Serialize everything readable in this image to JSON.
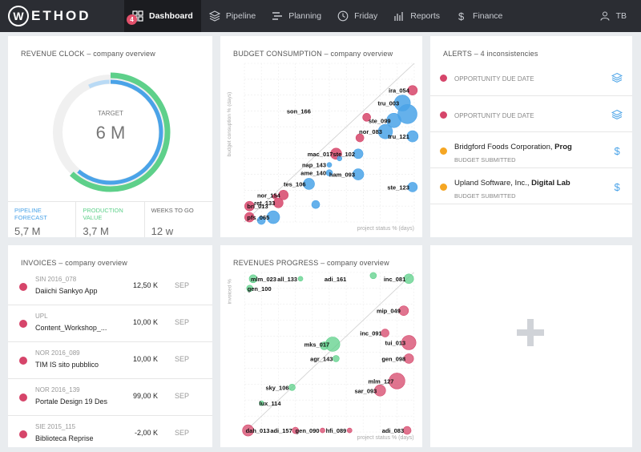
{
  "app": {
    "logo_letter": "W",
    "logo_text": "ETHOD"
  },
  "nav": {
    "items": [
      {
        "label": "Dashboard",
        "icon": "dashboard-grid-icon"
      },
      {
        "label": "Pipeline",
        "icon": "pipeline-layers-icon"
      },
      {
        "label": "Planning",
        "icon": "planning-bars-icon"
      },
      {
        "label": "Friday",
        "icon": "clock-icon"
      },
      {
        "label": "Reports",
        "icon": "bar-chart-icon"
      },
      {
        "label": "Finance",
        "icon": "dollar-icon"
      }
    ],
    "badge": "4",
    "user_initials": "TB"
  },
  "colors": {
    "red": "#d6456a",
    "blue": "#4aa3e8",
    "green": "#5ed08a",
    "orange": "#f5a623",
    "nav_bg": "#2b2d33"
  },
  "revenue_clock": {
    "title": "REVENUE CLOCK – company overview",
    "center_label": "TARGET",
    "center_value": "6 M",
    "green_fraction": 0.62,
    "blue_fraction": 0.61,
    "light_fraction": 0.07,
    "stats": [
      {
        "label": "PIPELINE FORECAST",
        "value": "5,7 M",
        "color": "#4aa3e8"
      },
      {
        "label": "PRODUCTION VALUE",
        "value": "3,7 M",
        "color": "#5ed08a"
      },
      {
        "label": "WEEKS TO GO",
        "value": "12 w",
        "color": "#666666"
      }
    ]
  },
  "budget": {
    "title": "BUDGET CONSUMPTION – company overview",
    "ylabel": "budget consuption % (days)",
    "xlabel": "project status % (days)"
  },
  "alerts": {
    "title": "ALERTS – 4 inconsistencies",
    "items": [
      {
        "type": "opportunity",
        "title": "OPPORTUNITY DUE DATE",
        "color": "#d6456a",
        "icon": "layers-icon"
      },
      {
        "type": "opportunity",
        "title": "OPPORTUNITY DUE DATE",
        "color": "#d6456a",
        "icon": "layers-icon"
      },
      {
        "type": "budget",
        "client": "Bridgford Foods Corporation,",
        "project": "Prog",
        "sub": "BUDGET SUBMITTED",
        "color": "#f5a623",
        "icon": "dollar-icon"
      },
      {
        "type": "budget",
        "client": "Upland Software, Inc.,",
        "project": "Digital Lab",
        "sub": "BUDGET SUBMITTED",
        "color": "#f5a623",
        "icon": "dollar-icon"
      }
    ]
  },
  "invoices": {
    "title": "INVOICES – company overview",
    "rows": [
      {
        "code": "SIN 2016_078",
        "name": "Daiichi Sankyo App",
        "amount": "12,50 K",
        "month": "SEP"
      },
      {
        "code": "UPL",
        "name": "Content_Workshop_...",
        "amount": "10,00 K",
        "month": "SEP"
      },
      {
        "code": "NOR 2016_089",
        "name": "TIM IS sito pubblico",
        "amount": "10,00 K",
        "month": "SEP"
      },
      {
        "code": "NOR 2016_139",
        "name": "Portale Design 19 Des",
        "amount": "99,00 K",
        "month": "SEP"
      },
      {
        "code": "SIE 2015_115",
        "name": "Biblioteca Reprise",
        "amount": "-2,00 K",
        "month": "SEP"
      }
    ]
  },
  "revenues_progress": {
    "title": "REVENUES PROGRESS – company overview",
    "ylabel": "invoiced %",
    "xlabel": "project status % (days)"
  },
  "chart_data": [
    {
      "type": "scatter",
      "title": "BUDGET CONSUMPTION – company overview",
      "xlabel": "project status % (days)",
      "ylabel": "budget consuption % (days)",
      "xlim": [
        0,
        100
      ],
      "ylim": [
        0,
        100
      ],
      "grid": true,
      "points": [
        {
          "label": "ira_054",
          "x": 99,
          "y": 83,
          "r": 6,
          "color": "red"
        },
        {
          "label": "tru_003",
          "x": 93,
          "y": 75,
          "r": 10,
          "color": "blue"
        },
        {
          "label": "son_166",
          "x": 41,
          "y": 70,
          "r": 0,
          "color": "red"
        },
        {
          "label": "",
          "x": 72,
          "y": 66,
          "r": 5,
          "color": "red"
        },
        {
          "label": "ste_099",
          "x": 88,
          "y": 64,
          "r": 9,
          "color": "blue"
        },
        {
          "label": "",
          "x": 96,
          "y": 68,
          "r": 12,
          "color": "blue"
        },
        {
          "label": "nor_083",
          "x": 83,
          "y": 57,
          "r": 9,
          "color": "blue"
        },
        {
          "label": "tru_121",
          "x": 99,
          "y": 54,
          "r": 7,
          "color": "blue"
        },
        {
          "label": "",
          "x": 68,
          "y": 53,
          "r": 5,
          "color": "red"
        },
        {
          "label": "ste_102",
          "x": 67,
          "y": 43,
          "r": 6,
          "color": "blue"
        },
        {
          "label": "mac_017",
          "x": 54,
          "y": 43,
          "r": 7,
          "color": "red"
        },
        {
          "label": "",
          "x": 56,
          "y": 40,
          "r": 3,
          "color": "blue"
        },
        {
          "label": "nap_143",
          "x": 50,
          "y": 36,
          "r": 3,
          "color": "blue"
        },
        {
          "label": "ame_140",
          "x": 50,
          "y": 31,
          "r": 4,
          "color": "blue"
        },
        {
          "label": "ham_093",
          "x": 67,
          "y": 30,
          "r": 7,
          "color": "blue"
        },
        {
          "label": "tes_106",
          "x": 38,
          "y": 24,
          "r": 7,
          "color": "blue"
        },
        {
          "label": "ste_123",
          "x": 99,
          "y": 22,
          "r": 6,
          "color": "blue"
        },
        {
          "label": "nor_154",
          "x": 23,
          "y": 17,
          "r": 6,
          "color": "red"
        },
        {
          "label": "ret_133",
          "x": 20,
          "y": 12,
          "r": 6,
          "color": "red"
        },
        {
          "label": "",
          "x": 42,
          "y": 11,
          "r": 5,
          "color": "blue"
        },
        {
          "label": "bri_013",
          "x": 3,
          "y": 10,
          "r": 6,
          "color": "red"
        },
        {
          "label": "",
          "x": 18,
          "y": 16,
          "r": 3,
          "color": "red"
        },
        {
          "label": "pfs_065",
          "x": 3,
          "y": 3,
          "r": 6,
          "color": "red"
        },
        {
          "label": "",
          "x": 17,
          "y": 3,
          "r": 8,
          "color": "blue"
        },
        {
          "label": "",
          "x": 10,
          "y": 1,
          "r": 5,
          "color": "blue"
        }
      ]
    },
    {
      "type": "scatter",
      "title": "REVENUES PROGRESS – company overview",
      "xlabel": "project status % (days)",
      "ylabel": "invoiced %",
      "xlim": [
        0,
        100
      ],
      "ylim": [
        0,
        100
      ],
      "grid": true,
      "points": [
        {
          "label": "mlm_023",
          "x": 5,
          "y": 96,
          "r": 5,
          "color": "green"
        },
        {
          "label": "all_133",
          "x": 33,
          "y": 96,
          "r": 3,
          "color": "green"
        },
        {
          "label": "adi_161",
          "x": 62,
          "y": 96,
          "r": 0,
          "color": "green"
        },
        {
          "label": "",
          "x": 76,
          "y": 98,
          "r": 4,
          "color": "green"
        },
        {
          "label": "inc_081",
          "x": 97,
          "y": 96,
          "r": 6,
          "color": "green"
        },
        {
          "label": "gen_100",
          "x": 3,
          "y": 90,
          "r": 4,
          "color": "green"
        },
        {
          "label": "mip_049",
          "x": 94,
          "y": 76,
          "r": 6,
          "color": "red"
        },
        {
          "label": "inc_091",
          "x": 83,
          "y": 62,
          "r": 5,
          "color": "red"
        },
        {
          "label": "mks_017",
          "x": 52,
          "y": 55,
          "r": 9,
          "color": "green"
        },
        {
          "label": "",
          "x": 47,
          "y": 54,
          "r": 5,
          "color": "green"
        },
        {
          "label": "tui_013",
          "x": 97,
          "y": 56,
          "r": 9,
          "color": "red"
        },
        {
          "label": "agr_143",
          "x": 54,
          "y": 46,
          "r": 4,
          "color": "green"
        },
        {
          "label": "gen_098",
          "x": 97,
          "y": 46,
          "r": 6,
          "color": "red"
        },
        {
          "label": "mlm_127",
          "x": 90,
          "y": 32,
          "r": 10,
          "color": "red"
        },
        {
          "label": "sky_106",
          "x": 28,
          "y": 28,
          "r": 4,
          "color": "green"
        },
        {
          "label": "sar_093",
          "x": 80,
          "y": 26,
          "r": 7,
          "color": "red"
        },
        {
          "label": "lux_114",
          "x": 10,
          "y": 18,
          "r": 3,
          "color": "green"
        },
        {
          "label": "dah_013",
          "x": 2,
          "y": 1,
          "r": 7,
          "color": "red"
        },
        {
          "label": "adi_157",
          "x": 30,
          "y": 1,
          "r": 4,
          "color": "red"
        },
        {
          "label": "gen_090",
          "x": 46,
          "y": 1,
          "r": 3,
          "color": "red"
        },
        {
          "label": "hfi_089",
          "x": 62,
          "y": 1,
          "r": 3,
          "color": "red"
        },
        {
          "label": "adi_083",
          "x": 96,
          "y": 1,
          "r": 5,
          "color": "red"
        }
      ]
    }
  ]
}
